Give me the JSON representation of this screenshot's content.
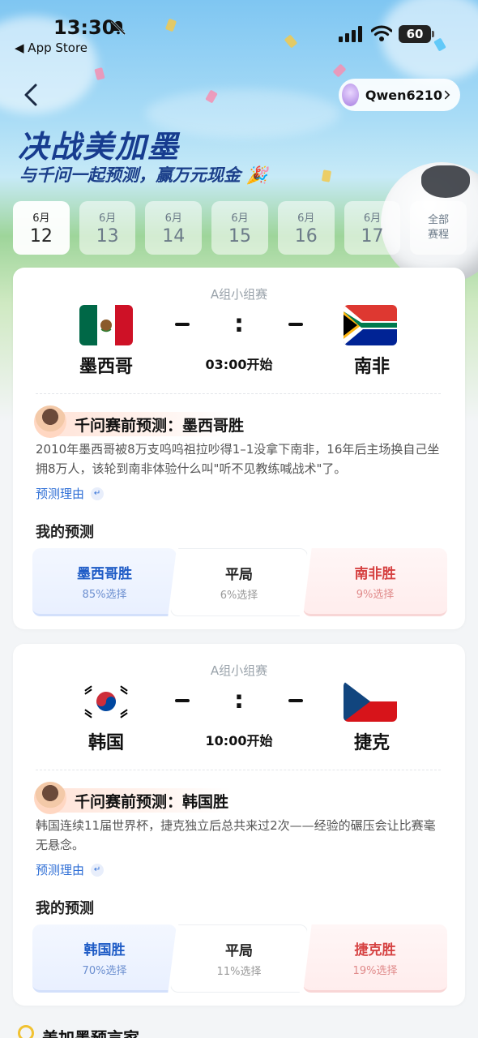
{
  "status_bar": {
    "time": "13:30",
    "back_app": "◀ App Store",
    "battery": "60"
  },
  "header": {
    "user_name": "Qwen6210",
    "title": "决战美加墨",
    "subtitle": "与千问一起预测，赢万元现金 🎉"
  },
  "date_tabs": [
    {
      "month": "6月",
      "day": "12"
    },
    {
      "month": "6月",
      "day": "13"
    },
    {
      "month": "6月",
      "day": "14"
    },
    {
      "month": "6月",
      "day": "15"
    },
    {
      "month": "6月",
      "day": "16"
    },
    {
      "month": "6月",
      "day": "17"
    },
    {
      "month": "全部",
      "day": "赛程"
    }
  ],
  "matches": [
    {
      "group": "A组小组赛",
      "home": "墨西哥",
      "away": "南非",
      "score_home": "-",
      "score_away": "-",
      "start_time": "03:00开始",
      "prediction_title": "千问赛前预测：墨西哥胜",
      "prediction_text": "2010年墨西哥被8万支呜呜祖拉吵得1–1没拿下南非，16年后主场换自己坐拥8万人，该轮到南非体验什么叫\"听不见教练喊战术\"了。",
      "reason_label": "预测理由",
      "my_prediction_label": "我的预测",
      "options": [
        {
          "label": "墨西哥胜",
          "percent": "85%选择"
        },
        {
          "label": "平局",
          "percent": "6%选择"
        },
        {
          "label": "南非胜",
          "percent": "9%选择"
        }
      ]
    },
    {
      "group": "A组小组赛",
      "home": "韩国",
      "away": "捷克",
      "score_home": "-",
      "score_away": "-",
      "start_time": "10:00开始",
      "prediction_title": "千问赛前预测：韩国胜",
      "prediction_text": "韩国连续11届世界杯，捷克独立后总共来过2次——经验的碾压会让比赛毫无悬念。",
      "reason_label": "预测理由",
      "my_prediction_label": "我的预测",
      "options": [
        {
          "label": "韩国胜",
          "percent": "70%选择"
        },
        {
          "label": "平局",
          "percent": "11%选择"
        },
        {
          "label": "捷克胜",
          "percent": "19%选择"
        }
      ]
    }
  ],
  "bottom_section": {
    "title": "美加墨预言家"
  },
  "colors": {
    "title": "#173c8f",
    "home_accent": "#1e5bc6",
    "away_accent": "#d64242",
    "link": "#2f6fd6"
  }
}
